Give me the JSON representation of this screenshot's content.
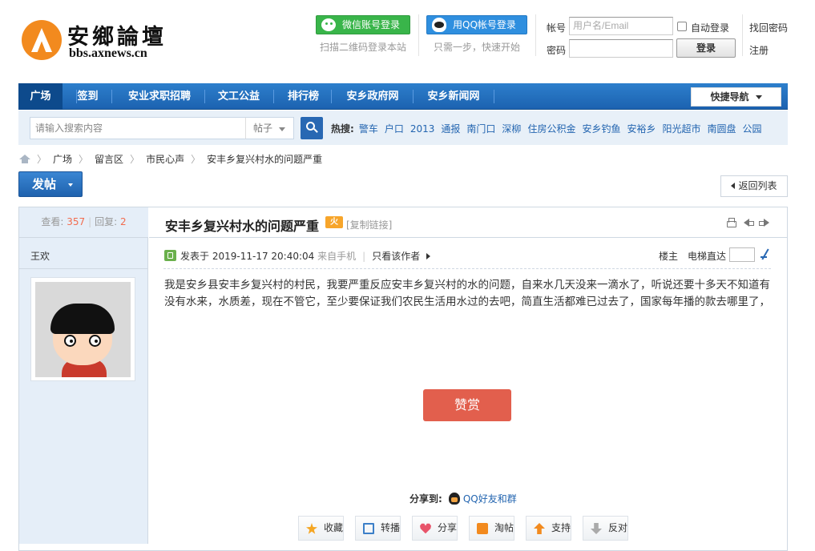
{
  "logo": {
    "name": "安鄉論壇",
    "url": "bbs.axnews.cn"
  },
  "login": {
    "wechat_label": "微信账号登录",
    "wechat_sub": "扫描二维码登录本站",
    "qq_label": "用QQ帐号登录",
    "qq_sub": "只需一步，快速开始",
    "account_label": "帐号",
    "account_placeholder": "用户名/Email",
    "password_label": "密码",
    "remember_label": "自动登录",
    "login_button": "登录",
    "forgot_label": "找回密码",
    "register_label": "注册"
  },
  "nav": {
    "items": [
      "广场",
      "签到",
      "安业求职招聘",
      "文工公益",
      "排行榜",
      "安乡政府网",
      "安乡新闻网"
    ],
    "active": "广场",
    "quick_nav": "快捷导航"
  },
  "search": {
    "placeholder": "请输入搜索内容",
    "type": "帖子",
    "hot_label": "热搜:",
    "hot": [
      "警车",
      "户口",
      "2013",
      "通报",
      "南门口",
      "深柳",
      "住房公积金",
      "安乡钓鱼",
      "安裕乡",
      "阳光超市",
      "南圆盘",
      "公园"
    ]
  },
  "breadcrumb": [
    "广场",
    "留言区",
    "市民心声",
    "安丰乡复兴村水的问题严重"
  ],
  "post_button": "发帖",
  "back_button": "返回列表",
  "thread": {
    "views_label": "查看:",
    "views": "357",
    "replies_label": "回复:",
    "replies": "2",
    "title": "安丰乡复兴村水的问题严重",
    "hot_badge": "火",
    "copy_link": "[复制链接]"
  },
  "post": {
    "author": "王欢",
    "posted_prefix": "发表于",
    "posted_time": "2019-11-17 20:40:04",
    "source": "来自手机",
    "only_author": "只看该作者",
    "floor_label": "楼主",
    "elevator_label": "电梯直达",
    "content": "我是安乡县安丰乡复兴村的村民，我要严重反应安丰乡复兴村的水的问题，自来水几天没来一滴水了，听说还要十多天不知道有没有水来，水质差，现在不管它，至少要保证我们农民生活用水过的去吧，简直生活都难已过去了，国家每年播的款去哪里了，",
    "reward_button": "赞赏",
    "share_label": "分享到:",
    "share_qq": "QQ好友和群",
    "actions": [
      "收藏",
      "转播",
      "分享",
      "淘帖",
      "支持",
      "反对"
    ]
  },
  "colors": {
    "nav_blue": "#1c62b0",
    "accent_red": "#e25f4d",
    "link_blue": "#2365b0",
    "count_orange": "#f26c4f"
  }
}
